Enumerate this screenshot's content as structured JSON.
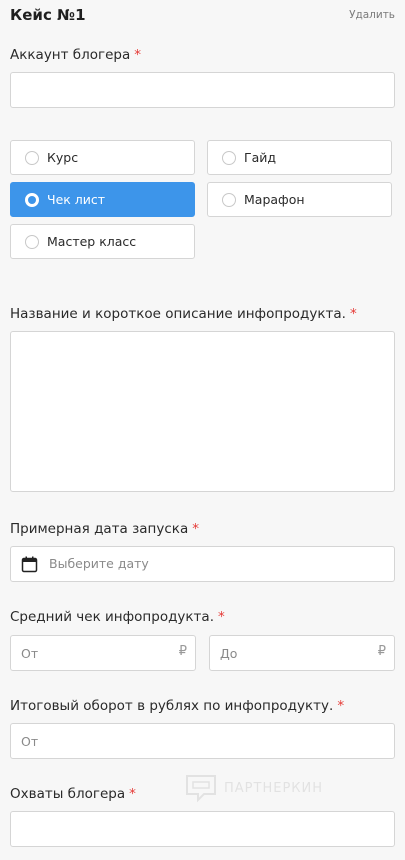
{
  "header": {
    "title": "Кейс №1",
    "delete_label": "Удалить"
  },
  "blogger_account": {
    "label": "Аккаунт блогера",
    "required_mark": "*",
    "value": ""
  },
  "product_type": {
    "options": [
      "Курс",
      "Гайд",
      "Чек лист",
      "Марафон",
      "Мастер класс"
    ],
    "selected": "Чек лист"
  },
  "description": {
    "label": "Название и короткое описание инфопродукта.",
    "required_mark": "*",
    "value": ""
  },
  "launch_date": {
    "label": "Примерная дата запуска",
    "required_mark": "*",
    "placeholder": "Выберите дату",
    "icon": "calendar-icon"
  },
  "avg_check": {
    "label": "Средний чек инфопродукта.",
    "required_mark": "*",
    "from_placeholder": "От",
    "to_placeholder": "До",
    "currency": "₽"
  },
  "turnover": {
    "label": "Итоговый оборот в рублях по инфопродукту.",
    "required_mark": "*",
    "placeholder": "От"
  },
  "reach": {
    "label": "Охваты блогера",
    "required_mark": "*",
    "value": ""
  },
  "watermark": {
    "text": "ПАРТНЕРКИН"
  },
  "colors": {
    "accent": "#3d95ea",
    "required": "#e53935",
    "border": "#d5d5d5"
  }
}
